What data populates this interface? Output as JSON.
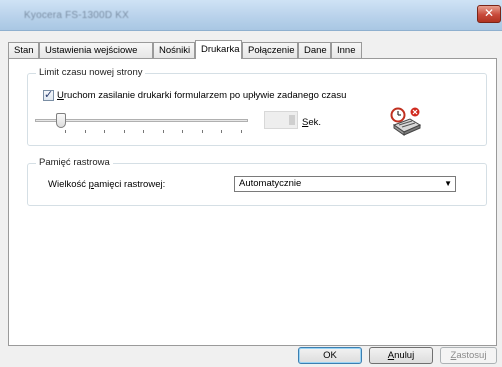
{
  "window": {
    "title": "Kyocera FS-1300D KX"
  },
  "tabs": [
    {
      "label": "Stan"
    },
    {
      "label": "Ustawienia wejściowe"
    },
    {
      "label": "Nośniki"
    },
    {
      "label": "Drukarka"
    },
    {
      "label": "Połączenie"
    },
    {
      "label": "Dane"
    },
    {
      "label": "Inne"
    }
  ],
  "active_tab": "Drukarka",
  "timeout_group": {
    "title": "Limit czasu nowej strony",
    "checkbox_label_underlined": "U",
    "checkbox_label_rest": "ruchom zasilanie drukarki formularzem po upływie zadanego czasu",
    "checked": true,
    "slider_level": 0.12,
    "seconds_underlined": "S",
    "seconds_rest": "ek."
  },
  "raster_group": {
    "title": "Pamięć rastrowa",
    "label_start": "Wielkość ",
    "label_underlined": "p",
    "label_end": "amięci rastrowej:",
    "select_value": "Automatycznie"
  },
  "buttons": {
    "ok": "OK",
    "cancel_underlined": "A",
    "cancel_rest": "nuluj",
    "apply_underlined": "Z",
    "apply_rest": "astosuj"
  },
  "colors": {
    "titlebar": "#b7d1ea",
    "close": "#c8493a",
    "accent": "#3c7fb1"
  }
}
